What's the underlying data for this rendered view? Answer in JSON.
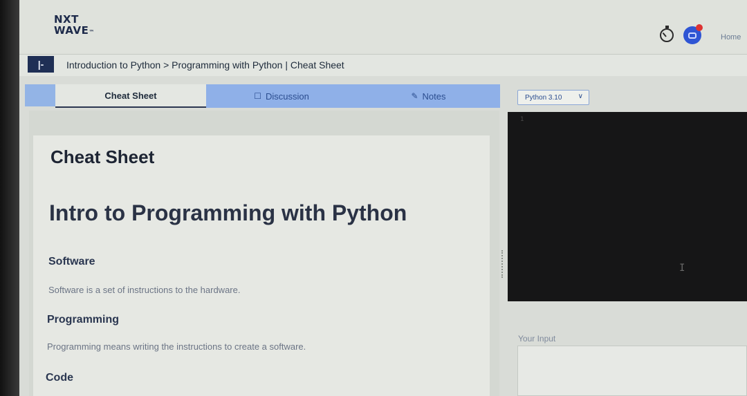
{
  "header": {
    "logo_line1": "NXT",
    "logo_line2": "WAVE",
    "logo_mark": "™",
    "home_label": "Home"
  },
  "breadcrumb": {
    "toggle_glyph": "|-",
    "text": "Introduction to Python > Programming with Python | Cheat Sheet"
  },
  "tabs": [
    {
      "label": "Cheat Sheet",
      "icon": ""
    },
    {
      "label": "Discussion",
      "icon": "chat-icon"
    },
    {
      "label": "Notes",
      "icon": "notes-icon"
    }
  ],
  "editor": {
    "language_select": "Python 3.10",
    "line_number": "1",
    "input_label": "Your Input"
  },
  "content": {
    "title": "Cheat Sheet",
    "heading": "Intro to Programming with Python",
    "sections": [
      {
        "title": "Software",
        "text": "Software is a set of instructions to the hardware."
      },
      {
        "title": "Programming",
        "text": "Programming means writing the instructions to create a software."
      },
      {
        "title": "Code",
        "text": ""
      }
    ]
  },
  "colors": {
    "brand_navy": "#1f2f55",
    "tab_blue": "#8fb0e8",
    "link_blue": "#2b4d8f",
    "editor_bg": "#161617",
    "notification_red": "#d33333"
  }
}
